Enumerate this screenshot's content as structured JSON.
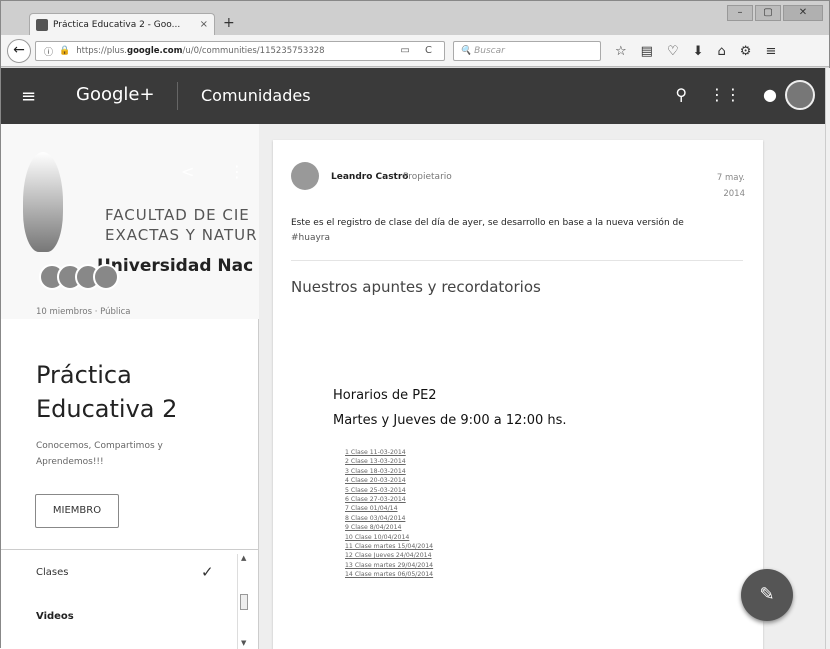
{
  "browser": {
    "tab_title": "Práctica Educativa 2 - Goo...",
    "tab_close": "×",
    "new_tab": "+",
    "url_prefix": "https://plus.",
    "url_host": "google.com",
    "url_path": "/u/0/communities/115235753328",
    "search_placeholder": "Buscar",
    "window_buttons": [
      "–",
      "▢",
      "✕"
    ]
  },
  "gplus": {
    "logo": "Google+",
    "section": "Comunidades"
  },
  "community": {
    "cover_line1": "FACULTAD DE CIE",
    "cover_line2": "EXACTAS Y NATUR",
    "cover_line3": "Universidad Nac",
    "meta": "10 miembros · Pública",
    "title": "Práctica Educativa 2",
    "tagline": "Conocemos, Compartimos y Aprendemos!!!",
    "member_button": "MIEMBRO",
    "categories": [
      {
        "label": "Clases",
        "selected": true
      },
      {
        "label": "Videos",
        "selected": false
      }
    ]
  },
  "post": {
    "author": "Leandro Castro",
    "role": "Propietario",
    "date_line1": "7 may.",
    "date_line2": "2014",
    "text": "Este es el registro de clase del día de ayer, se desarrollo en base a la nueva versión de",
    "hashtag": "#huayra",
    "attachment_title": "Nuestros apuntes y recordatorios",
    "schedule_line1": "Horarios de PE2",
    "schedule_line2": "Martes y Jueves de 9:00 a 12:00 hs.",
    "classes": [
      "1 Clase 11-03-2014",
      "2 Clase 13-03-2014",
      "3 Clase 18-03-2014",
      "4 Clase 20-03-2014",
      "5 Clase 25-03-2014",
      "6 Clase 27-03-2014",
      "7 Clase 01/04/14",
      "8 Clase 03/04/2014",
      "9 Clase 8/04/2014",
      "10 Clase 10/04/2014",
      "11 Clase martes 15/04/2014",
      "12 Clase Jueves 24/04/2014",
      "13 Clase martes 29/04/2014",
      "14 Clase martes 06/05/2014"
    ]
  }
}
